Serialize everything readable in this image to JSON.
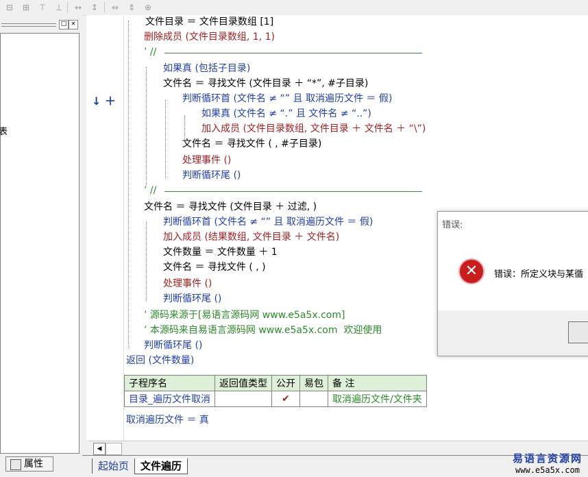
{
  "toolbar": {
    "icons": [
      "align-left-icon",
      "align-center-icon",
      "align-top-icon",
      "align-middle-icon",
      "space-horizontal-icon",
      "space-vertical-icon",
      "same-width-icon",
      "same-height-icon",
      "same-size-icon"
    ]
  },
  "left_panel": {
    "min_label": "□",
    "close_label": "×",
    "partial_text": "表",
    "tab_label": "属性"
  },
  "code": {
    "lines": [
      {
        "t": "文件目录 ＝ 文件目录数组 [1]"
      },
      {
        "t": "删除成员 (文件目录数组, 1, 1)"
      },
      {
        "t": "’ //"
      },
      {
        "t": "如果真 (包括子目录)"
      },
      {
        "t": "文件名 ＝ 寻找文件 (文件目录 ＋ “*”, #子目录)"
      },
      {
        "t": "判断循环首 (文件名 ≠ “” 且 取消遍历文件 ＝ 假)"
      },
      {
        "t": "如果真 (文件名 ≠ “.” 且 文件名 ≠ “..”)"
      },
      {
        "t": "加入成员 (文件目录数组, 文件目录 ＋ 文件名 ＋ “\\”)"
      },
      {
        "t": "文件名 ＝ 寻找文件 ( , #子目录)"
      },
      {
        "t": "处理事件 ()"
      },
      {
        "t": "判断循环尾 ()"
      },
      {
        "t": "’ //"
      },
      {
        "t": "文件名 ＝ 寻找文件 (文件目录 ＋ 过滤, )"
      },
      {
        "t": "判断循环首 (文件名 ≠ “” 且 取消遍历文件 ＝ 假)"
      },
      {
        "t": "加入成员 (结果数组, 文件目录 ＋ 文件名)"
      },
      {
        "t": "文件数量 ＝ 文件数量 ＋ 1"
      },
      {
        "t": "文件名 ＝ 寻找文件 ( , )"
      },
      {
        "t": "处理事件 ()"
      },
      {
        "t": "判断循环尾 ()"
      },
      {
        "t": "’ 源码来源于[易语言源码网 www.e5a5x.com]"
      },
      {
        "t": "’ 本源码来自易语言源码网 www.e5a5x.com  欢迎使用"
      },
      {
        "t": "判断循环尾 ()"
      },
      {
        "t": "返回 (文件数量)"
      }
    ],
    "gutter_mark": "↓ ＋"
  },
  "subprogram_table": {
    "headers": [
      "子程序名",
      "返回值类型",
      "公开",
      "易包",
      "备 注"
    ],
    "row": [
      "目录_遍历文件取消",
      "",
      "✔",
      "",
      "取消遍历文件/文件夹"
    ]
  },
  "after_table": "取消遍历文件 ＝ 真",
  "tabs": {
    "home": "起始页",
    "current": "文件遍历"
  },
  "scroll": {
    "left_arrow": "◀"
  },
  "watermark": {
    "line1": "易语言资源网",
    "line2": "www.e5a5x.com"
  },
  "dialog": {
    "title": "错误:",
    "icon_glyph": "✕",
    "message": "错误：所定义块与某循"
  }
}
